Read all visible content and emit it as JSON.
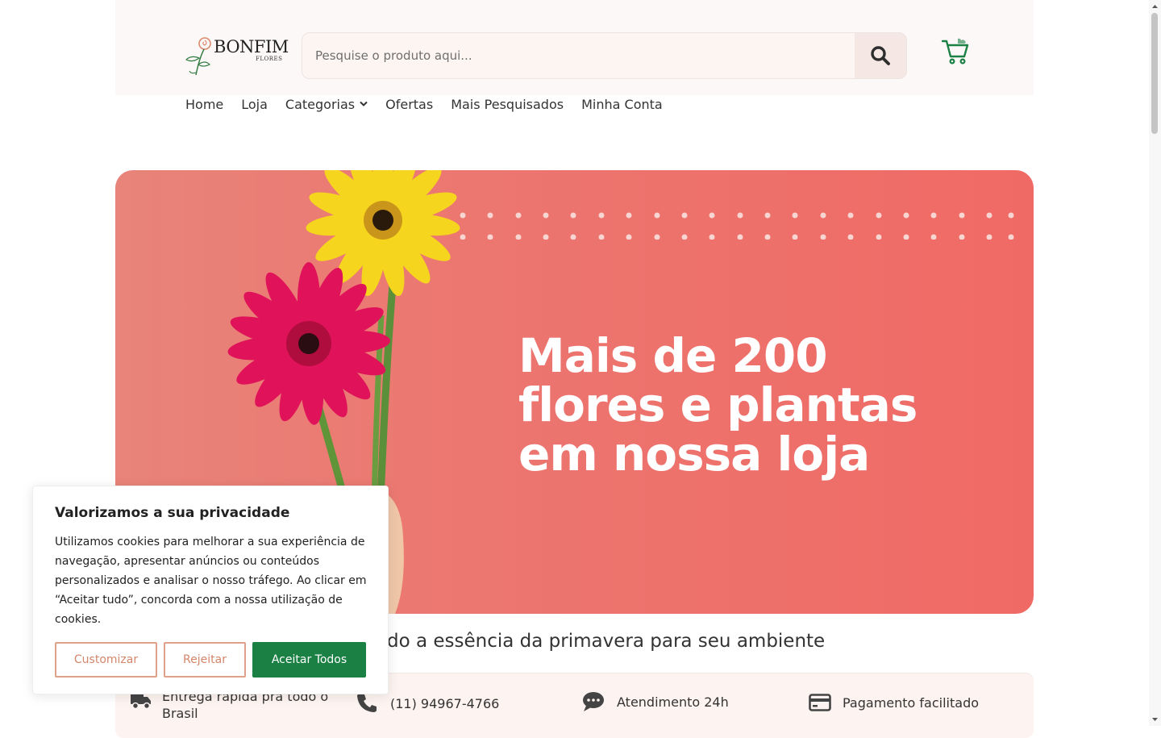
{
  "header": {
    "logo_word": "BONFIM",
    "logo_sub": "FLORES",
    "search_placeholder": "Pesquise o produto aqui...",
    "search_icon": "search-icon",
    "cart_icon": "cart-icon"
  },
  "nav": {
    "items": [
      "Home",
      "Loja",
      "Categorias",
      "Ofertas",
      "Mais Pesquisados",
      "Minha Conta"
    ]
  },
  "hero": {
    "title_lines": [
      "Mais de 200",
      "flores e plantas",
      "em nossa loja"
    ]
  },
  "tagline": "do a essência da primavera para seu ambiente",
  "features": [
    {
      "icon": "truck-icon",
      "text": "Entrega rápida pra todo o Brasil"
    },
    {
      "icon": "phone-icon",
      "text": "(11) 94967-4766"
    },
    {
      "icon": "chat-icon",
      "text": "Atendimento 24h"
    },
    {
      "icon": "credit-card-icon",
      "text": "Pagamento facilitado"
    }
  ],
  "cookie": {
    "title": "Valorizamos a sua privacidade",
    "text": "Utilizamos cookies para melhorar a sua experiência de navegação, apresentar anúncios ou conteúdos personalizados e analisar o nosso tráfego. Ao clicar em “Aceitar tudo”, concorda com a nossa utilização de cookies.",
    "customize": "Customizar",
    "reject": "Rejeitar",
    "accept": "Aceitar Todos"
  },
  "colors": {
    "accent_green": "#1b8044",
    "hero_bg": "#f06a65",
    "outline_btn": "#d4866b"
  }
}
